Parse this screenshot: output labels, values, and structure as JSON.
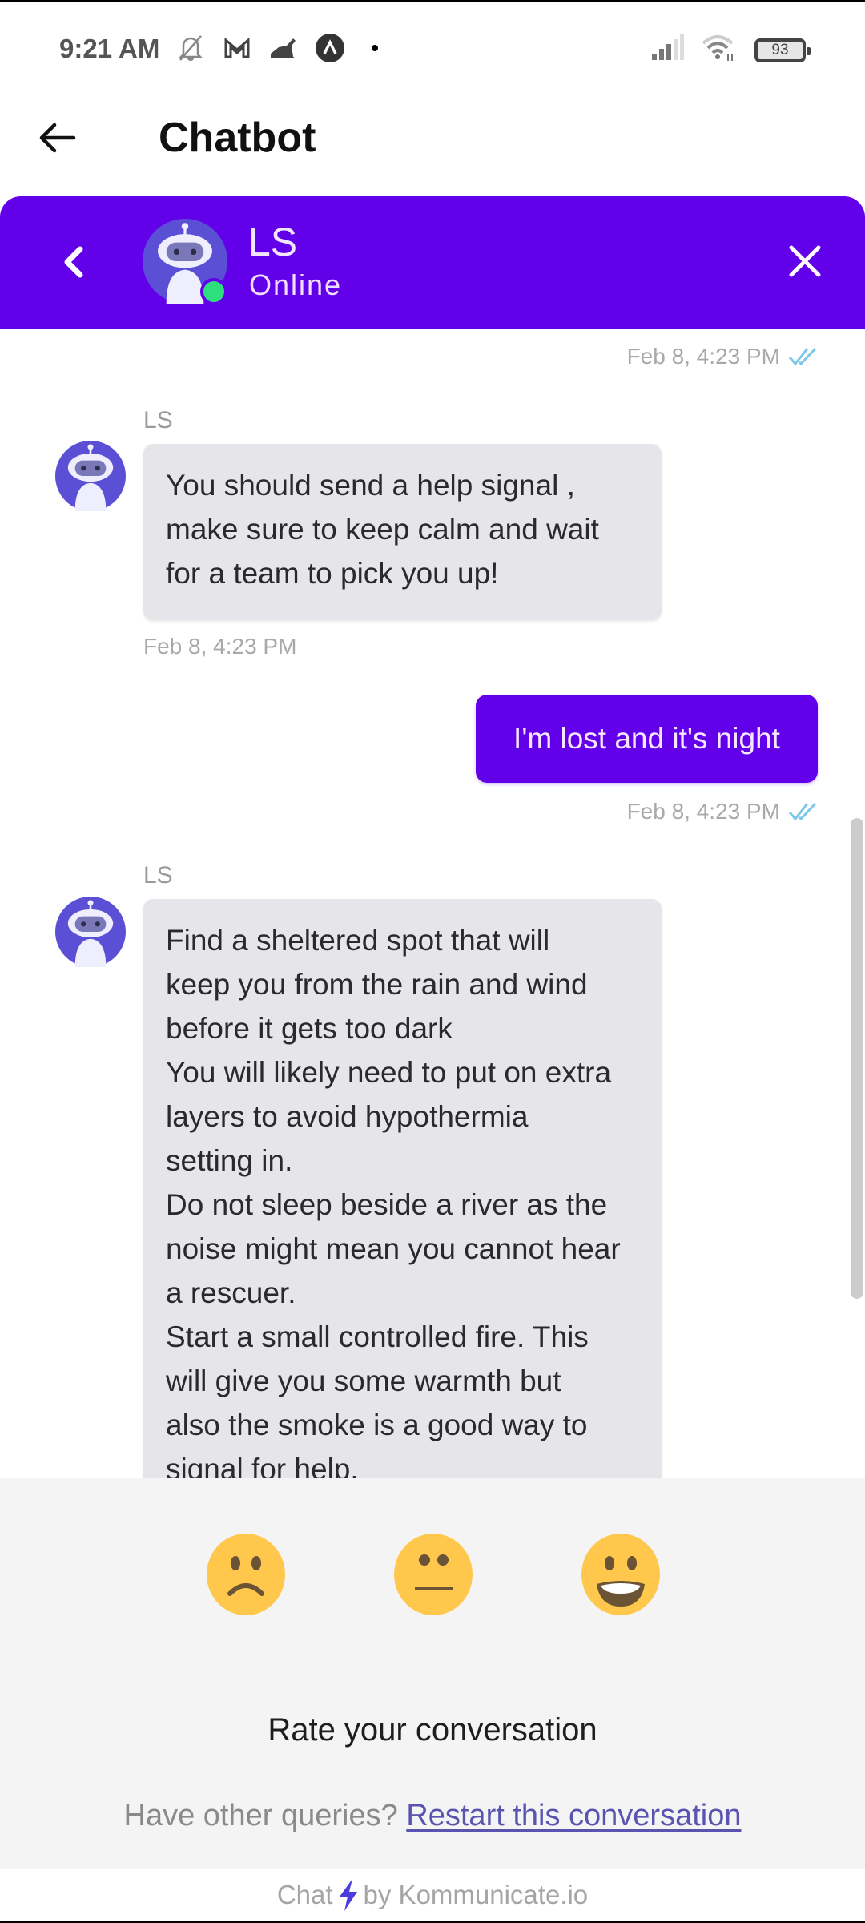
{
  "status_bar": {
    "time": "9:21 AM",
    "left_icons": [
      "bell-off-icon",
      "gmail-icon",
      "app-notification-icon",
      "app-circle-icon",
      "dot-icon"
    ],
    "right_icons": [
      "signal-icon",
      "wifi-icon",
      "battery-icon"
    ],
    "battery_level": "93"
  },
  "app_bar": {
    "title": "Chatbot"
  },
  "chat_header": {
    "bot_name": "LS",
    "status": "Online",
    "colors": {
      "primary": "#6200ea",
      "online": "#2de07d"
    }
  },
  "messages": [
    {
      "type": "user-timestamp",
      "timestamp": "Feb 8, 4:23 PM",
      "read": true
    },
    {
      "type": "bot",
      "sender": "LS",
      "text": "You should send a help signal ,\nmake sure to keep calm and wait\nfor a team to pick you up!",
      "timestamp": "Feb 8, 4:23 PM"
    },
    {
      "type": "user",
      "text": "I'm lost and it's night",
      "timestamp": "Feb 8, 4:23 PM",
      "read": true
    },
    {
      "type": "bot",
      "sender": "LS",
      "text": "Find a sheltered spot that will\nkeep you from the rain and wind\nbefore it gets too dark\nYou will likely need to put on extra\nlayers to avoid hypothermia\nsetting in.\nDo not sleep beside a river as the\nnoise might mean you cannot hear\na rescuer.\nStart a small controlled fire. This\nwill give you some warmth but\nalso the smoke is a good way to\nsignal for help."
    }
  ],
  "feedback": {
    "ratings": [
      {
        "name": "sad",
        "icon": "sad-face-icon"
      },
      {
        "name": "neutral",
        "icon": "neutral-face-icon"
      },
      {
        "name": "happy",
        "icon": "happy-face-icon"
      }
    ],
    "prompt": "Rate your conversation",
    "other_queries": "Have other queries?",
    "restart_link": "Restart this conversation"
  },
  "footer": {
    "prefix": "Chat",
    "suffix": "by Kommunicate.io"
  }
}
